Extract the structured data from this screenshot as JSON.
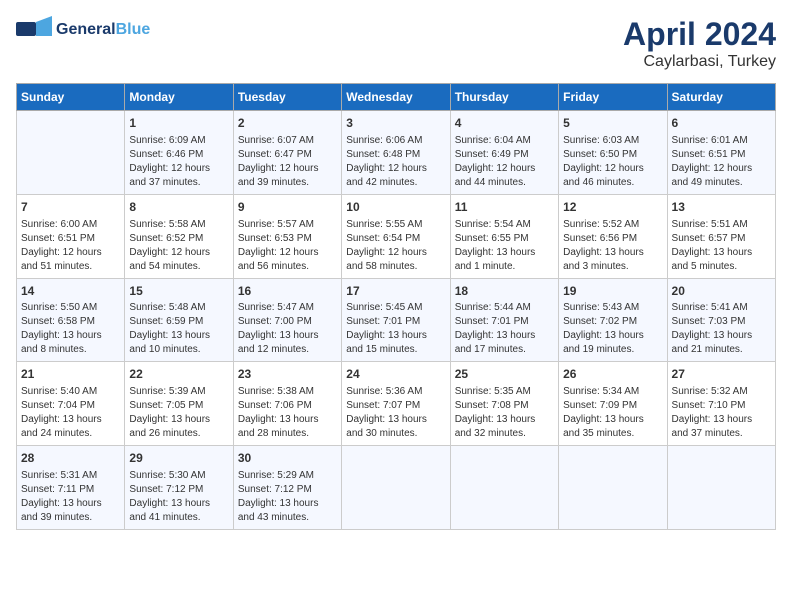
{
  "header": {
    "logo_line1": "General",
    "logo_line2": "Blue",
    "main_title": "April 2024",
    "sub_title": "Caylarbasi, Turkey"
  },
  "columns": [
    "Sunday",
    "Monday",
    "Tuesday",
    "Wednesday",
    "Thursday",
    "Friday",
    "Saturday"
  ],
  "weeks": [
    [
      {
        "day": "",
        "info": ""
      },
      {
        "day": "1",
        "info": "Sunrise: 6:09 AM\nSunset: 6:46 PM\nDaylight: 12 hours\nand 37 minutes."
      },
      {
        "day": "2",
        "info": "Sunrise: 6:07 AM\nSunset: 6:47 PM\nDaylight: 12 hours\nand 39 minutes."
      },
      {
        "day": "3",
        "info": "Sunrise: 6:06 AM\nSunset: 6:48 PM\nDaylight: 12 hours\nand 42 minutes."
      },
      {
        "day": "4",
        "info": "Sunrise: 6:04 AM\nSunset: 6:49 PM\nDaylight: 12 hours\nand 44 minutes."
      },
      {
        "day": "5",
        "info": "Sunrise: 6:03 AM\nSunset: 6:50 PM\nDaylight: 12 hours\nand 46 minutes."
      },
      {
        "day": "6",
        "info": "Sunrise: 6:01 AM\nSunset: 6:51 PM\nDaylight: 12 hours\nand 49 minutes."
      }
    ],
    [
      {
        "day": "7",
        "info": "Sunrise: 6:00 AM\nSunset: 6:51 PM\nDaylight: 12 hours\nand 51 minutes."
      },
      {
        "day": "8",
        "info": "Sunrise: 5:58 AM\nSunset: 6:52 PM\nDaylight: 12 hours\nand 54 minutes."
      },
      {
        "day": "9",
        "info": "Sunrise: 5:57 AM\nSunset: 6:53 PM\nDaylight: 12 hours\nand 56 minutes."
      },
      {
        "day": "10",
        "info": "Sunrise: 5:55 AM\nSunset: 6:54 PM\nDaylight: 12 hours\nand 58 minutes."
      },
      {
        "day": "11",
        "info": "Sunrise: 5:54 AM\nSunset: 6:55 PM\nDaylight: 13 hours\nand 1 minute."
      },
      {
        "day": "12",
        "info": "Sunrise: 5:52 AM\nSunset: 6:56 PM\nDaylight: 13 hours\nand 3 minutes."
      },
      {
        "day": "13",
        "info": "Sunrise: 5:51 AM\nSunset: 6:57 PM\nDaylight: 13 hours\nand 5 minutes."
      }
    ],
    [
      {
        "day": "14",
        "info": "Sunrise: 5:50 AM\nSunset: 6:58 PM\nDaylight: 13 hours\nand 8 minutes."
      },
      {
        "day": "15",
        "info": "Sunrise: 5:48 AM\nSunset: 6:59 PM\nDaylight: 13 hours\nand 10 minutes."
      },
      {
        "day": "16",
        "info": "Sunrise: 5:47 AM\nSunset: 7:00 PM\nDaylight: 13 hours\nand 12 minutes."
      },
      {
        "day": "17",
        "info": "Sunrise: 5:45 AM\nSunset: 7:01 PM\nDaylight: 13 hours\nand 15 minutes."
      },
      {
        "day": "18",
        "info": "Sunrise: 5:44 AM\nSunset: 7:01 PM\nDaylight: 13 hours\nand 17 minutes."
      },
      {
        "day": "19",
        "info": "Sunrise: 5:43 AM\nSunset: 7:02 PM\nDaylight: 13 hours\nand 19 minutes."
      },
      {
        "day": "20",
        "info": "Sunrise: 5:41 AM\nSunset: 7:03 PM\nDaylight: 13 hours\nand 21 minutes."
      }
    ],
    [
      {
        "day": "21",
        "info": "Sunrise: 5:40 AM\nSunset: 7:04 PM\nDaylight: 13 hours\nand 24 minutes."
      },
      {
        "day": "22",
        "info": "Sunrise: 5:39 AM\nSunset: 7:05 PM\nDaylight: 13 hours\nand 26 minutes."
      },
      {
        "day": "23",
        "info": "Sunrise: 5:38 AM\nSunset: 7:06 PM\nDaylight: 13 hours\nand 28 minutes."
      },
      {
        "day": "24",
        "info": "Sunrise: 5:36 AM\nSunset: 7:07 PM\nDaylight: 13 hours\nand 30 minutes."
      },
      {
        "day": "25",
        "info": "Sunrise: 5:35 AM\nSunset: 7:08 PM\nDaylight: 13 hours\nand 32 minutes."
      },
      {
        "day": "26",
        "info": "Sunrise: 5:34 AM\nSunset: 7:09 PM\nDaylight: 13 hours\nand 35 minutes."
      },
      {
        "day": "27",
        "info": "Sunrise: 5:32 AM\nSunset: 7:10 PM\nDaylight: 13 hours\nand 37 minutes."
      }
    ],
    [
      {
        "day": "28",
        "info": "Sunrise: 5:31 AM\nSunset: 7:11 PM\nDaylight: 13 hours\nand 39 minutes."
      },
      {
        "day": "29",
        "info": "Sunrise: 5:30 AM\nSunset: 7:12 PM\nDaylight: 13 hours\nand 41 minutes."
      },
      {
        "day": "30",
        "info": "Sunrise: 5:29 AM\nSunset: 7:12 PM\nDaylight: 13 hours\nand 43 minutes."
      },
      {
        "day": "",
        "info": ""
      },
      {
        "day": "",
        "info": ""
      },
      {
        "day": "",
        "info": ""
      },
      {
        "day": "",
        "info": ""
      }
    ]
  ]
}
